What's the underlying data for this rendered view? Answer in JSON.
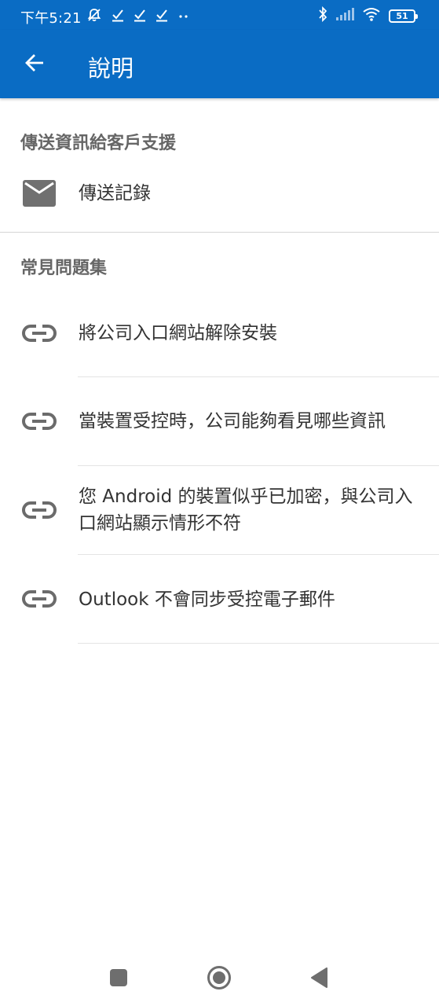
{
  "status_bar": {
    "time": "下午5:21",
    "battery_level": "51",
    "icons": [
      "mute-bell-icon",
      "check-icon",
      "check-icon",
      "check-icon",
      "more-dots-icon",
      "bluetooth-icon",
      "signal-icon",
      "wifi-icon",
      "battery-icon"
    ]
  },
  "app_bar": {
    "title": "說明",
    "back_icon": "arrow-left-icon",
    "color": "#0a6cc4"
  },
  "support_section": {
    "header": "傳送資訊給客戶支援",
    "items": [
      {
        "label": "傳送記錄",
        "icon": "mail-icon"
      }
    ]
  },
  "faq_section": {
    "header": "常見問題集",
    "items": [
      {
        "label": "將公司入口網站解除安裝",
        "icon": "link-icon"
      },
      {
        "label": "當裝置受控時，公司能夠看見哪些資訊",
        "icon": "link-icon"
      },
      {
        "label": "您 Android 的裝置似乎已加密，與公司入口網站顯示情形不符",
        "icon": "link-icon"
      },
      {
        "label": "Outlook 不會同步受控電子郵件",
        "icon": "link-icon"
      }
    ]
  },
  "nav_bar": {
    "buttons": [
      "recents-square-icon",
      "home-circle-icon",
      "back-triangle-icon"
    ]
  }
}
